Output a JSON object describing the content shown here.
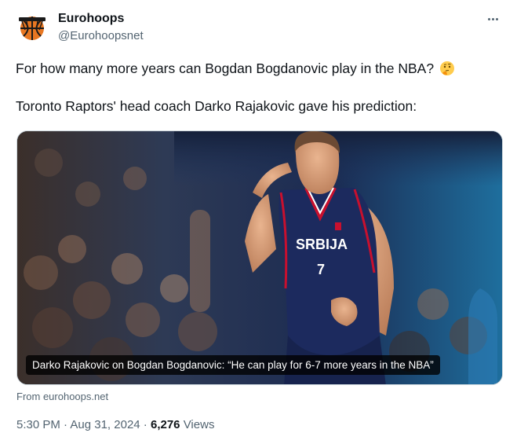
{
  "author": {
    "name": "Eurohoops",
    "handle": "@Eurohoopsnet",
    "avatar_icon": "eurohoops-logo-icon"
  },
  "more_icon": "more-options-icon",
  "tweet": {
    "line1": "For how many more years can Bogdan Bogdanovic play in the NBA?",
    "line1_emoji": "thinking-face-emoji",
    "line2": "Toronto Raptors' head coach Darko Rajakovic gave his prediction:"
  },
  "media": {
    "caption": "Darko Rajakovic on Bogdan Bogdanovic: “He can play for 6-7 more years in the NBA”",
    "jersey_text": "SRBIJA",
    "jersey_number": "7"
  },
  "source": "From eurohoops.net",
  "meta": {
    "time": "5:30 PM",
    "sep1": " · ",
    "date": "Aug 31, 2024",
    "sep2": " · ",
    "views_count": "6,276",
    "views_label": " Views"
  },
  "colors": {
    "text": "#0f1419",
    "secondary": "#536471",
    "border": "#cfd9de",
    "jersey": "#1c2a5e"
  }
}
